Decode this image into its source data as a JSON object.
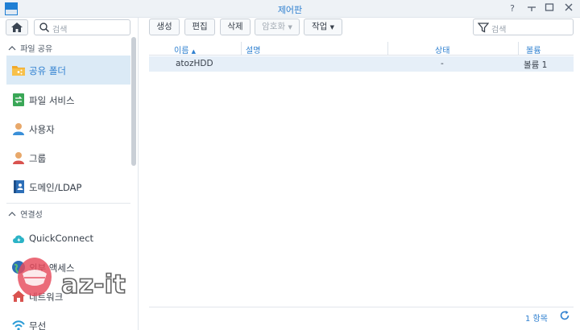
{
  "window": {
    "title": "제어판",
    "help_icon": "question-mark-icon",
    "pin_icon": "pin-icon",
    "minimize_icon": "minimize-icon",
    "maximize_icon": "maximize-icon",
    "close_icon": "close-icon"
  },
  "sidebar": {
    "search_placeholder": "검색",
    "sections": [
      {
        "label": "파일 공유"
      },
      {
        "label": "연결성"
      }
    ],
    "items": [
      {
        "label": "공유 폴더",
        "icon": "shared-folder-icon",
        "active": true
      },
      {
        "label": "파일 서비스",
        "icon": "file-services-icon"
      },
      {
        "label": "사용자",
        "icon": "user-icon"
      },
      {
        "label": "그룹",
        "icon": "group-icon"
      },
      {
        "label": "도메인/LDAP",
        "icon": "domain-ldap-icon"
      },
      {
        "label": "QuickConnect",
        "icon": "quickconnect-icon"
      },
      {
        "label": "외부 액세스",
        "icon": "external-access-icon"
      },
      {
        "label": "네트워크",
        "icon": "network-icon"
      },
      {
        "label": "무선",
        "icon": "wireless-icon"
      }
    ]
  },
  "toolbar": {
    "create": "생성",
    "edit": "편집",
    "delete": "삭제",
    "encryption": "암호화",
    "action": "작업",
    "search_placeholder": "검색"
  },
  "table": {
    "columns": [
      "이름",
      "설명",
      "상태",
      "볼륨"
    ],
    "sort_indicator": "▲",
    "rows": [
      {
        "name": "atozHDD",
        "description": "",
        "status": "-",
        "volume": "볼륨 1"
      }
    ]
  },
  "footer": {
    "count": "1 항목"
  },
  "watermark": {
    "text": "az-it"
  },
  "colors": {
    "accent": "#2f80d0",
    "selected_row": "#e6eff8",
    "active_nav": "#dbeaf6"
  }
}
